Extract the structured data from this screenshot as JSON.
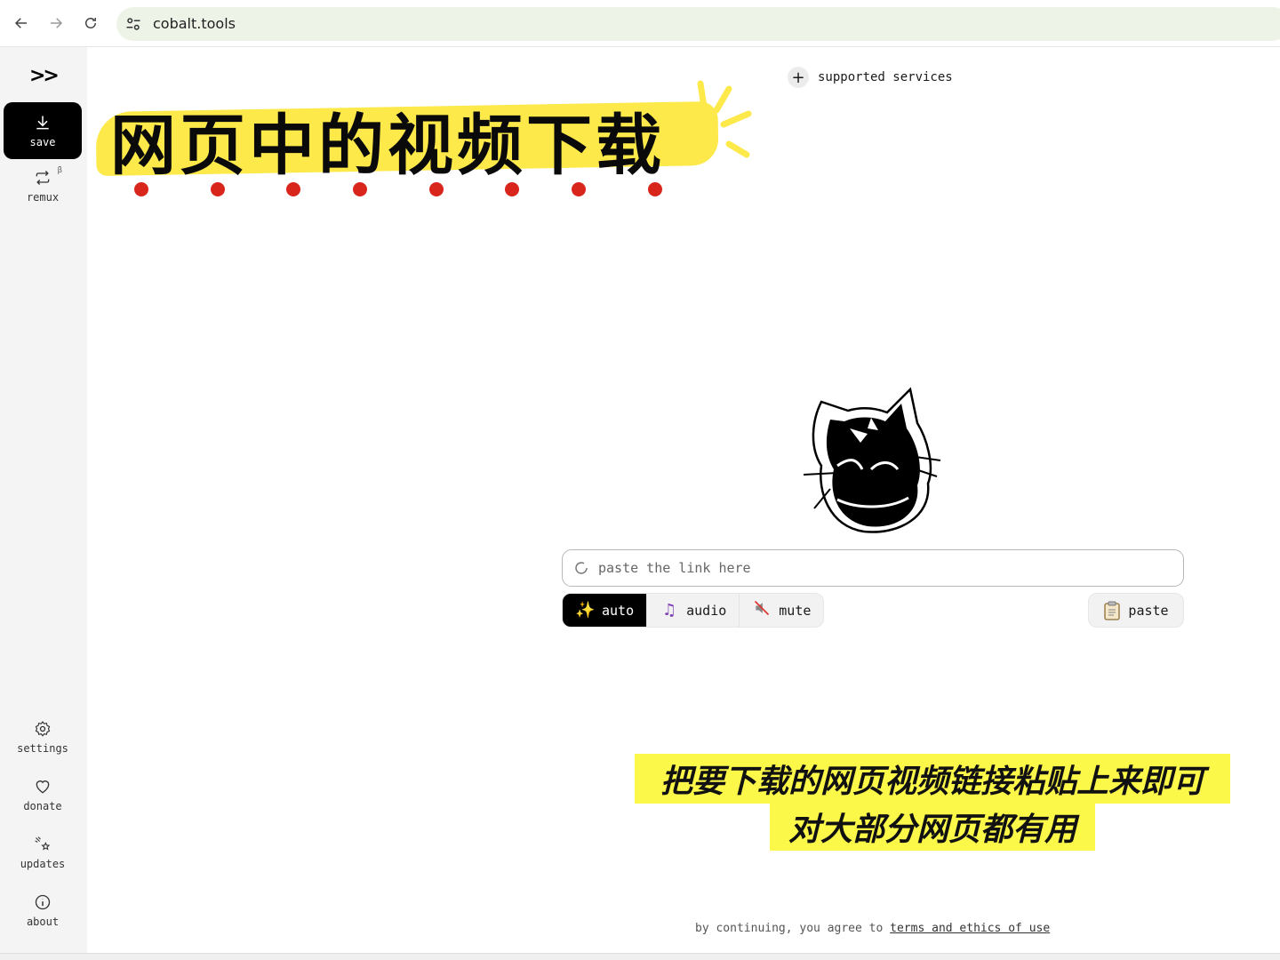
{
  "browser": {
    "url": "cobalt.tools"
  },
  "sidebar": {
    "logo": ">>",
    "items": [
      {
        "label": "save",
        "icon": "download-icon",
        "active": true
      },
      {
        "label": "remux",
        "icon": "remux-icon",
        "badge": "β"
      },
      {
        "label": "settings",
        "icon": "gear-icon"
      },
      {
        "label": "donate",
        "icon": "heart-icon"
      },
      {
        "label": "updates",
        "icon": "sparkle-icon"
      },
      {
        "label": "about",
        "icon": "info-icon"
      }
    ]
  },
  "banner": {
    "text": "网页中的视频下载"
  },
  "header": {
    "supported_services": "supported services"
  },
  "main": {
    "input_placeholder": "paste the link here",
    "modes": [
      {
        "label": "auto",
        "icon": "sparkles-icon",
        "active": true
      },
      {
        "label": "audio",
        "icon": "music-notes-icon"
      },
      {
        "label": "mute",
        "icon": "muted-speaker-icon"
      }
    ],
    "paste_label": "paste"
  },
  "captions": {
    "line1": "把要下载的网页视频链接粘贴上来即可",
    "line2": "对大部分网页都有用"
  },
  "footer": {
    "prefix": "by continuing, you agree to",
    "link": "terms and ethics of use"
  },
  "colors": {
    "banner_yellow": "#fde94a",
    "caption_yellow": "#fbf84a",
    "dot_red": "#d9261c",
    "active_black": "#000000",
    "address_bg": "#eef3e8"
  }
}
